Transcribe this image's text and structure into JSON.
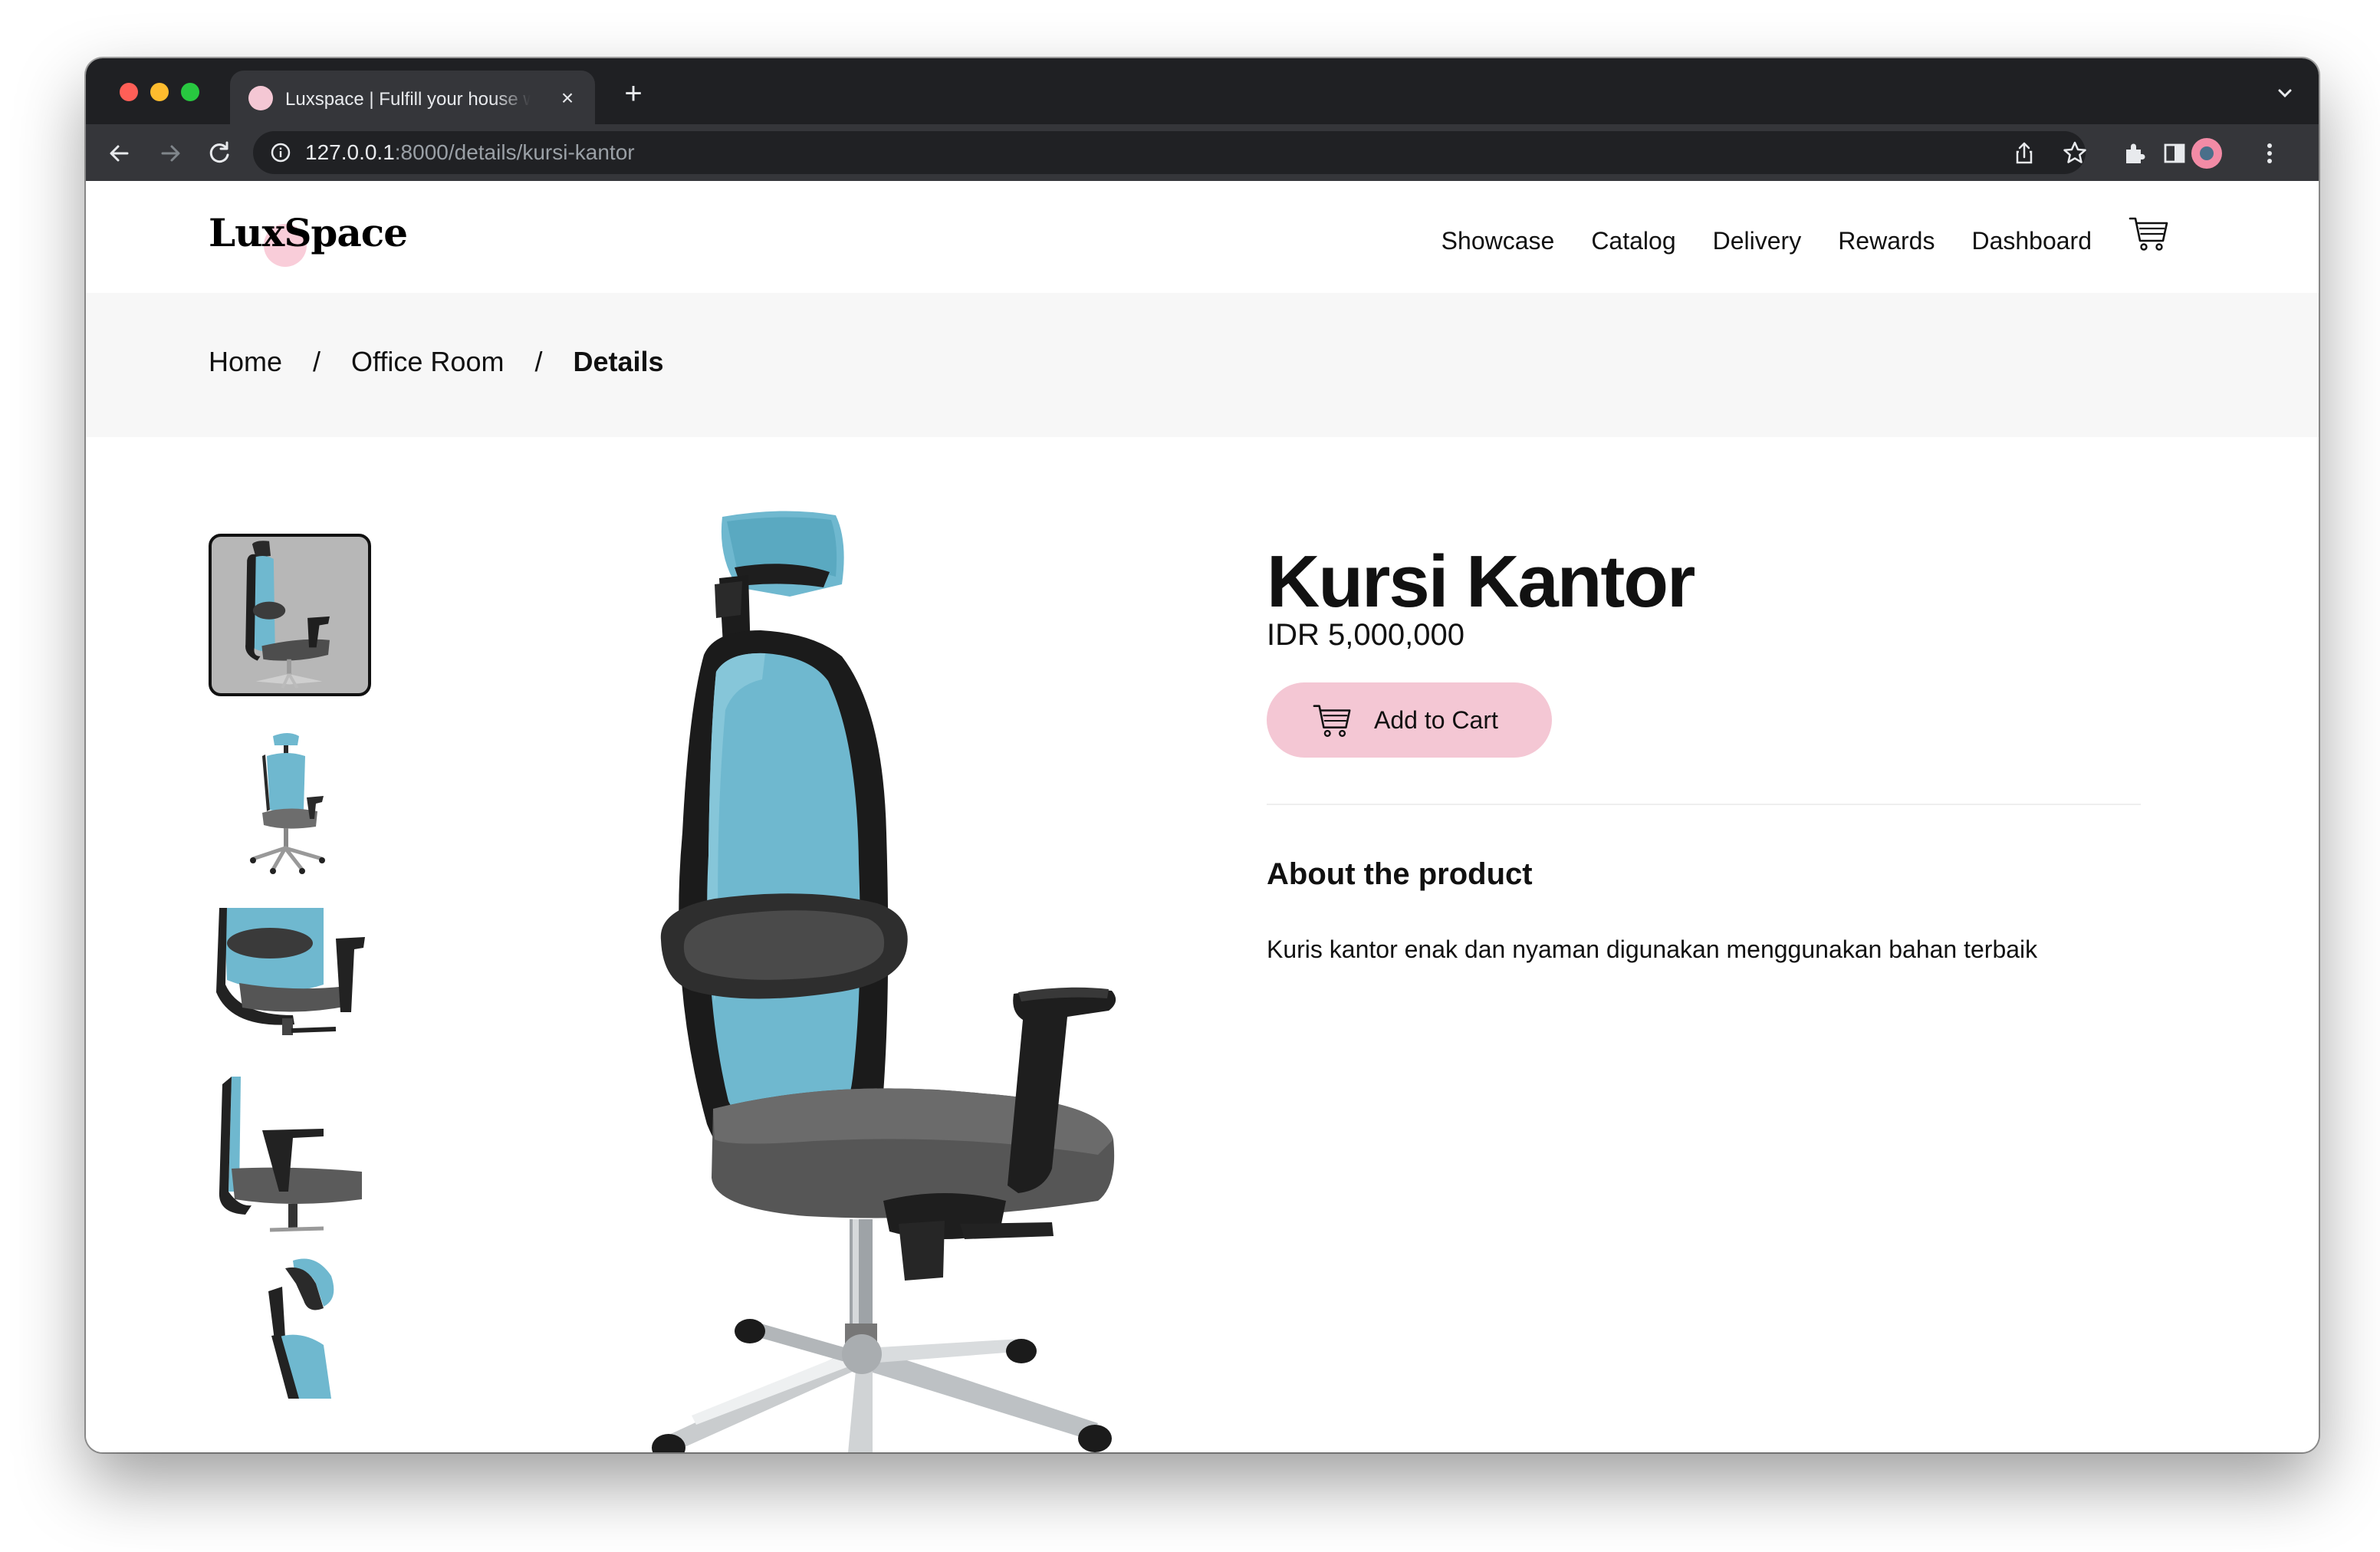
{
  "browser": {
    "tab_title": "Luxspace | Fulfill your house with beautiful furniture",
    "tab_close": "×",
    "new_tab": "+",
    "url_host": "127.0.0.1",
    "url_path": ":8000/details/kursi-kantor",
    "icons": [
      "back-arrow-icon",
      "forward-arrow-icon",
      "reload-icon",
      "info-icon",
      "share-icon",
      "bookmark-star-icon",
      "extensions-icon",
      "side-panel-icon",
      "profile-avatar",
      "more-menu-icon",
      "tab-list-chevron-icon"
    ]
  },
  "brand": {
    "logo": "LuxSpace",
    "accent": "#f4c7d4"
  },
  "nav": {
    "items": [
      {
        "label": "Showcase"
      },
      {
        "label": "Catalog"
      },
      {
        "label": "Delivery"
      },
      {
        "label": "Rewards"
      },
      {
        "label": "Dashboard"
      }
    ],
    "cart_icon": "cart-icon"
  },
  "breadcrumb": {
    "items": [
      "Home",
      "Office Room",
      "Details"
    ],
    "separator": "/"
  },
  "product": {
    "name": "Kursi Kantor",
    "price": "IDR 5,000,000",
    "add_to_cart": "Add to Cart",
    "about_title": "About the product",
    "description": "Kuris kantor enak dan nyaman digunakan menggunakan bahan terbaik",
    "thumbnails": [
      "chair-thumbnail-1",
      "chair-thumbnail-2",
      "chair-thumbnail-3",
      "chair-thumbnail-4",
      "chair-thumbnail-5"
    ],
    "active_thumbnail": 1
  }
}
